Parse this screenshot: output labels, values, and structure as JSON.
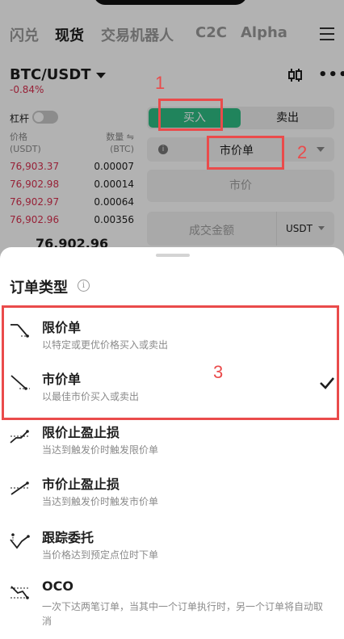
{
  "nav": {
    "tabs": [
      {
        "label": "闪兑",
        "active": false
      },
      {
        "label": "现货",
        "active": true
      },
      {
        "label": "交易机器人",
        "active": false
      },
      {
        "label": "C2C",
        "active": false
      },
      {
        "label": "Alpha",
        "active": false
      }
    ],
    "menu_icon": "hamburger-icon"
  },
  "market": {
    "pair": "BTC/USDT",
    "change": "-0.84%",
    "change_color": "#d9304f"
  },
  "leverage": {
    "label": "杠杆",
    "enabled": false
  },
  "orderbook": {
    "price_header": "价格",
    "price_unit": "(USDT)",
    "qty_header": "数量 ⇋",
    "qty_unit": "(BTC)",
    "rows": [
      {
        "price": "76,903.37",
        "qty": "0.00007"
      },
      {
        "price": "76,902.98",
        "qty": "0.00014"
      },
      {
        "price": "76,902.97",
        "qty": "0.00064"
      },
      {
        "price": "76,902.96",
        "qty": "0.00356"
      }
    ],
    "last_price": "76,902.96"
  },
  "trade_form": {
    "buy_label": "买入",
    "sell_label": "卖出",
    "buy_color": "#2ebd85",
    "order_type": "市价单",
    "price_placeholder": "市价",
    "amount_placeholder": "成交金额",
    "amount_unit": "USDT"
  },
  "sheet": {
    "title": "订单类型",
    "options": [
      {
        "title": "限价单",
        "desc": "以特定或更优价格买入或卖出",
        "icon": "limit-order-icon",
        "selected": false
      },
      {
        "title": "市价单",
        "desc": "以最佳市价买入或卖出",
        "icon": "market-order-icon",
        "selected": true
      },
      {
        "title": "限价止盈止损",
        "desc": "当达到触发价时触发限价单",
        "icon": "limit-tpsl-icon",
        "selected": false
      },
      {
        "title": "市价止盈止损",
        "desc": "当达到触发价时触发市价单",
        "icon": "market-tpsl-icon",
        "selected": false
      },
      {
        "title": "跟踪委托",
        "desc": "当价格达到预定点位时下单",
        "icon": "trailing-order-icon",
        "selected": false
      },
      {
        "title": "OCO",
        "desc": "一次下达两笔订单，当其中一个订单执行时，另一个订单将自动取消",
        "icon": "oco-icon",
        "selected": false
      }
    ]
  },
  "annotations": {
    "color": "#ea4b4b",
    "labels": [
      "1",
      "2",
      "3"
    ]
  }
}
